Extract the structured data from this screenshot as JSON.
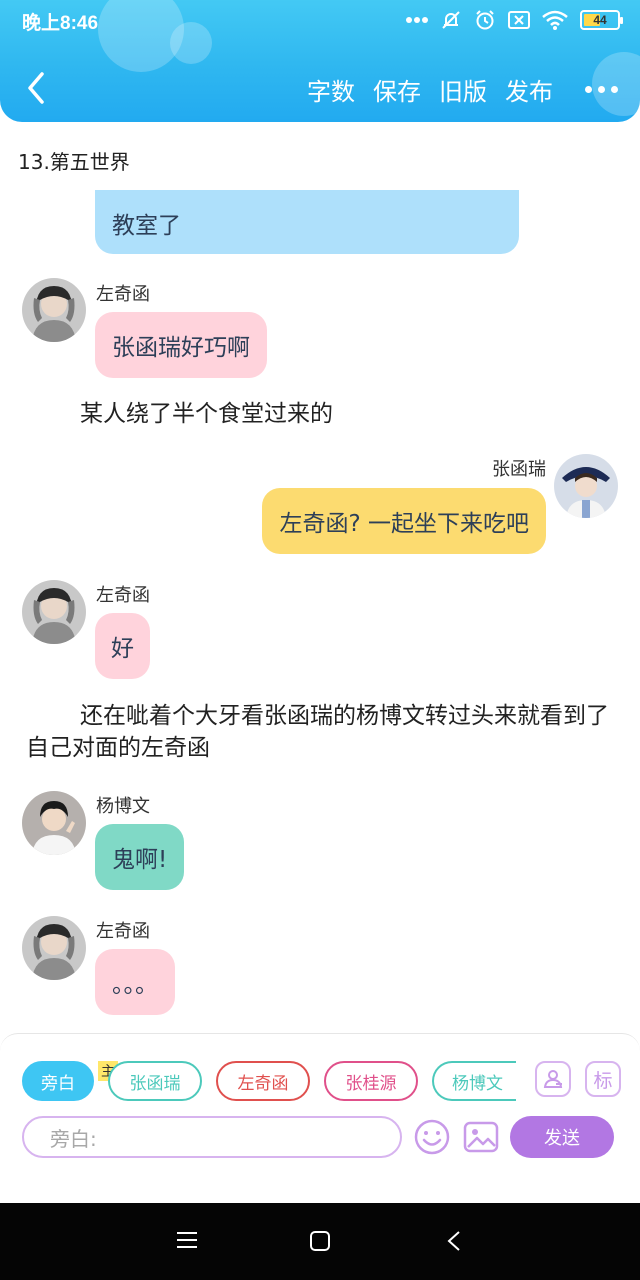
{
  "status_bar": {
    "time": "晚上8:46",
    "battery": "44",
    "icons": [
      "signal-dots-icon",
      "mute-icon",
      "alarm-icon",
      "sim-off-icon",
      "wifi-icon",
      "battery-icon"
    ]
  },
  "toolbar": {
    "back_icon": "chevron-left-icon",
    "word_count": "字数",
    "save": "保存",
    "old_version": "旧版",
    "publish": "发布",
    "more_icon": "more-horizontal-icon"
  },
  "chapter_title": "13.第五世界",
  "messages": [
    {
      "type": "partial",
      "text": "教室了",
      "color": "#aee0fb"
    },
    {
      "type": "left",
      "speaker": "左奇函",
      "text": "张函瑞好巧啊",
      "color": "#ffd3dc"
    },
    {
      "type": "narration",
      "text": "某人绕了半个食堂过来的"
    },
    {
      "type": "right",
      "speaker": "张函瑞",
      "text": "左奇函? 一起坐下来吃吧",
      "color": "#fcdb70"
    },
    {
      "type": "left",
      "speaker": "左奇函",
      "text": "好",
      "color": "#ffd3dc"
    },
    {
      "type": "narration",
      "text": "还在呲着个大牙看张函瑞的杨博文转过头来就看到了自己对面的左奇函"
    },
    {
      "type": "left",
      "speaker": "杨博文",
      "text": "鬼啊!",
      "color": "#80d9c6"
    },
    {
      "type": "left",
      "speaker": "左奇函",
      "text": "。。。",
      "color": "#ffd3dc"
    }
  ],
  "roles": [
    {
      "label": "旁白",
      "color": "#3ec6f3",
      "active": true
    },
    {
      "label": "张函瑞",
      "color": "#4cc9bb"
    },
    {
      "label": "左奇函",
      "color": "#e0504e"
    },
    {
      "label": "张桂源",
      "color": "#e0508a"
    },
    {
      "label": "杨博文",
      "color": "#4cc9bb"
    }
  ],
  "master_badge": "主",
  "tools": {
    "character_icon": "person-card-icon",
    "tag_label": "标"
  },
  "input": {
    "placeholder": "旁白:"
  },
  "emoji_icon": "smiley-icon",
  "image_icon": "image-icon",
  "send": "发送",
  "system_nav": [
    "menu-icon",
    "home-square-icon",
    "back-triangle-icon"
  ],
  "colors": {
    "accent": "#2fb7f0",
    "purple": "#b277e3"
  }
}
